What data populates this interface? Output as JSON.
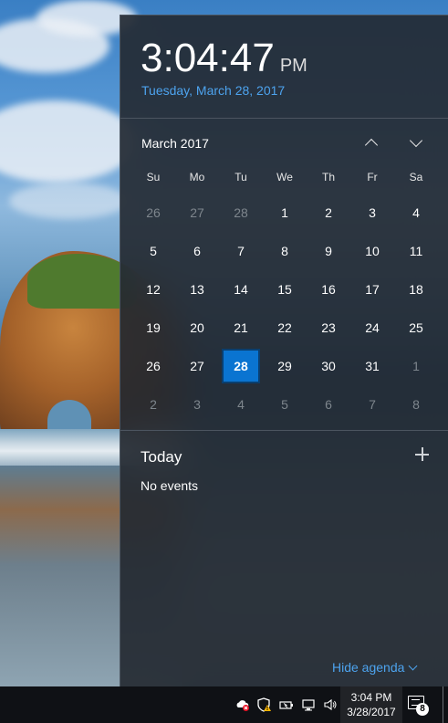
{
  "clock": {
    "time": "3:04:47",
    "ampm": "PM",
    "date_link": "Tuesday, March 28, 2017"
  },
  "calendar": {
    "month_label": "March 2017",
    "prev_icon": "chevron-up-icon",
    "next_icon": "chevron-down-icon",
    "days_of_week": [
      "Su",
      "Mo",
      "Tu",
      "We",
      "Th",
      "Fr",
      "Sa"
    ],
    "days": [
      {
        "d": "26",
        "dim": true
      },
      {
        "d": "27",
        "dim": true
      },
      {
        "d": "28",
        "dim": true
      },
      {
        "d": "1"
      },
      {
        "d": "2"
      },
      {
        "d": "3"
      },
      {
        "d": "4"
      },
      {
        "d": "5"
      },
      {
        "d": "6"
      },
      {
        "d": "7"
      },
      {
        "d": "8"
      },
      {
        "d": "9"
      },
      {
        "d": "10"
      },
      {
        "d": "11"
      },
      {
        "d": "12"
      },
      {
        "d": "13"
      },
      {
        "d": "14"
      },
      {
        "d": "15"
      },
      {
        "d": "16"
      },
      {
        "d": "17"
      },
      {
        "d": "18"
      },
      {
        "d": "19"
      },
      {
        "d": "20"
      },
      {
        "d": "21"
      },
      {
        "d": "22"
      },
      {
        "d": "23"
      },
      {
        "d": "24"
      },
      {
        "d": "25"
      },
      {
        "d": "26"
      },
      {
        "d": "27"
      },
      {
        "d": "28",
        "today": true
      },
      {
        "d": "29"
      },
      {
        "d": "30"
      },
      {
        "d": "31"
      },
      {
        "d": "1",
        "dim": true
      },
      {
        "d": "2",
        "dim": true
      },
      {
        "d": "3",
        "dim": true
      },
      {
        "d": "4",
        "dim": true
      },
      {
        "d": "5",
        "dim": true
      },
      {
        "d": "6",
        "dim": true
      },
      {
        "d": "7",
        "dim": true
      },
      {
        "d": "8",
        "dim": true
      }
    ]
  },
  "agenda": {
    "title": "Today",
    "add_icon": "plus-icon",
    "empty_text": "No events",
    "hide_label": "Hide agenda"
  },
  "taskbar": {
    "time": "3:04 PM",
    "date": "3/28/2017",
    "notification_count": "8",
    "tray_icons": [
      "onedrive-error-icon",
      "defender-warning-icon",
      "battery-icon",
      "network-icon",
      "volume-icon"
    ]
  },
  "colors": {
    "accent": "#0a74d1",
    "link": "#4da3ee",
    "flyout_bg": "#22282f"
  }
}
